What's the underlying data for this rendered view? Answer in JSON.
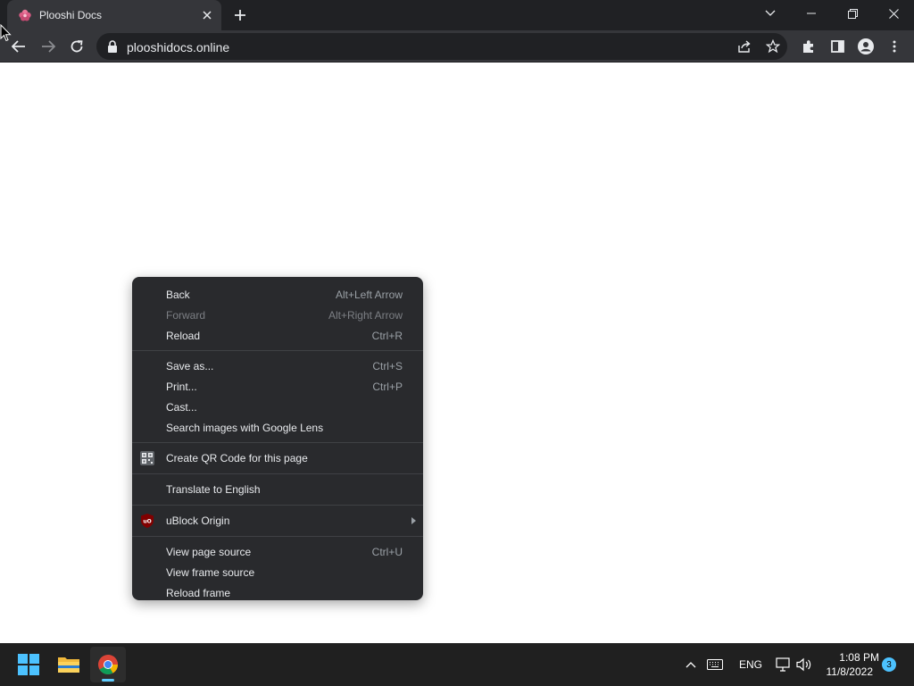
{
  "browser": {
    "tab_title": "Plooshi Docs",
    "url": "plooshidocs.online",
    "favicon": "plooshi-flower-icon",
    "accent_color": "#e8eaed"
  },
  "context_menu": {
    "groups": [
      [
        {
          "label": "Back",
          "shortcut": "Alt+Left Arrow",
          "enabled": true
        },
        {
          "label": "Forward",
          "shortcut": "Alt+Right Arrow",
          "enabled": false
        },
        {
          "label": "Reload",
          "shortcut": "Ctrl+R",
          "enabled": true
        }
      ],
      [
        {
          "label": "Save as...",
          "shortcut": "Ctrl+S",
          "enabled": true
        },
        {
          "label": "Print...",
          "shortcut": "Ctrl+P",
          "enabled": true
        },
        {
          "label": "Cast...",
          "shortcut": "",
          "enabled": true
        },
        {
          "label": "Search images with Google Lens",
          "shortcut": "",
          "enabled": true
        }
      ],
      [
        {
          "label": "Create QR Code for this page",
          "shortcut": "",
          "enabled": true,
          "icon": "qr-code-icon"
        }
      ],
      [
        {
          "label": "Translate to English",
          "shortcut": "",
          "enabled": true
        }
      ],
      [
        {
          "label": "uBlock Origin",
          "shortcut": "",
          "enabled": true,
          "icon": "ublock-origin-icon",
          "submenu": true
        }
      ],
      [
        {
          "label": "View page source",
          "shortcut": "Ctrl+U",
          "enabled": true
        },
        {
          "label": "View frame source",
          "shortcut": "",
          "enabled": true
        },
        {
          "label": "Reload frame",
          "shortcut": "",
          "enabled": true
        }
      ]
    ]
  },
  "taskbar": {
    "language": "ENG",
    "time": "1:08 PM",
    "date": "11/8/2022",
    "notification_count": "3",
    "accent_color": "#60cdff"
  }
}
